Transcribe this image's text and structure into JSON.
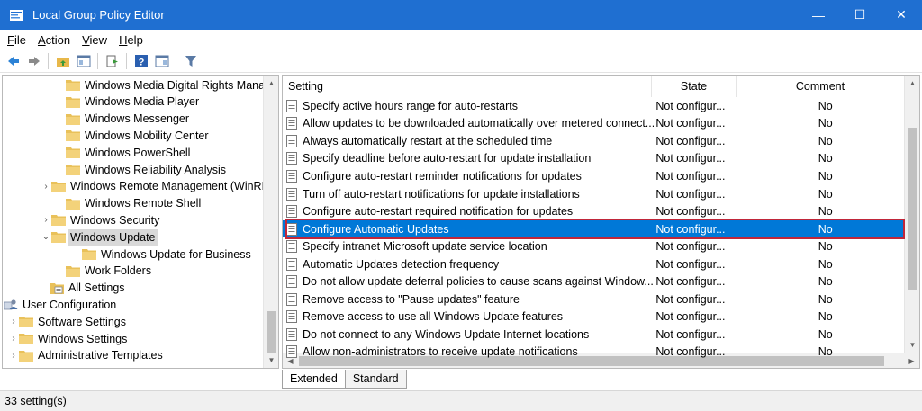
{
  "window": {
    "title": "Local Group Policy Editor",
    "accent_color": "#1f6fd1",
    "controls": {
      "minimize": "—",
      "maximize": "☐",
      "close": "✕"
    }
  },
  "menu": {
    "items": [
      {
        "label_u": "F",
        "label_rest": "ile"
      },
      {
        "label_u": "A",
        "label_rest": "ction"
      },
      {
        "label_u": "V",
        "label_rest": "iew"
      },
      {
        "label_u": "H",
        "label_rest": "elp"
      }
    ]
  },
  "toolbar": {
    "icons": [
      "back-arrow-icon",
      "forward-arrow-icon",
      "up-folder-icon",
      "show-hide-tree-icon",
      "export-list-icon",
      "help-icon",
      "show-hide-action-pane-icon",
      "filter-icon"
    ]
  },
  "tree": {
    "items": [
      {
        "label": "Windows Media Digital Rights Management",
        "expander": ""
      },
      {
        "label": "Windows Media Player",
        "expander": ""
      },
      {
        "label": "Windows Messenger",
        "expander": ""
      },
      {
        "label": "Windows Mobility Center",
        "expander": ""
      },
      {
        "label": "Windows PowerShell",
        "expander": ""
      },
      {
        "label": "Windows Reliability Analysis",
        "expander": ""
      },
      {
        "label": "Windows Remote Management (WinRM)",
        "expander": "›"
      },
      {
        "label": "Windows Remote Shell",
        "expander": ""
      },
      {
        "label": "Windows Security",
        "expander": "›"
      },
      {
        "label": "Windows Update",
        "expander": "⌄",
        "selected": true
      },
      {
        "label": "Windows Update for Business",
        "expander": ""
      },
      {
        "label": "Work Folders",
        "expander": ""
      },
      {
        "label": "All Settings",
        "expander": ""
      },
      {
        "label": "User Configuration",
        "expander": "⌄"
      },
      {
        "label": "Software Settings",
        "expander": "›"
      },
      {
        "label": "Windows Settings",
        "expander": "›"
      },
      {
        "label": "Administrative Templates",
        "expander": "›"
      }
    ]
  },
  "list": {
    "columns": {
      "setting": "Setting",
      "state": "State",
      "comment": "Comment"
    },
    "rows": [
      {
        "setting": "Specify active hours range for auto-restarts",
        "state": "Not configur...",
        "comment": "No"
      },
      {
        "setting": "Allow updates to be downloaded automatically over metered connect...",
        "state": "Not configur...",
        "comment": "No"
      },
      {
        "setting": "Always automatically restart at the scheduled time",
        "state": "Not configur...",
        "comment": "No"
      },
      {
        "setting": "Specify deadline before auto-restart for update installation",
        "state": "Not configur...",
        "comment": "No"
      },
      {
        "setting": "Configure auto-restart reminder notifications for updates",
        "state": "Not configur...",
        "comment": "No"
      },
      {
        "setting": "Turn off auto-restart notifications for update installations",
        "state": "Not configur...",
        "comment": "No"
      },
      {
        "setting": "Configure auto-restart required notification for updates",
        "state": "Not configur...",
        "comment": "No"
      },
      {
        "setting": "Configure Automatic Updates",
        "state": "Not configur...",
        "comment": "No",
        "selected": true
      },
      {
        "setting": "Specify intranet Microsoft update service location",
        "state": "Not configur...",
        "comment": "No"
      },
      {
        "setting": "Automatic Updates detection frequency",
        "state": "Not configur...",
        "comment": "No"
      },
      {
        "setting": "Do not allow update deferral policies to cause scans against Window...",
        "state": "Not configur...",
        "comment": "No"
      },
      {
        "setting": "Remove access to \"Pause updates\" feature",
        "state": "Not configur...",
        "comment": "No"
      },
      {
        "setting": "Remove access to use all Windows Update features",
        "state": "Not configur...",
        "comment": "No"
      },
      {
        "setting": "Do not connect to any Windows Update Internet locations",
        "state": "Not configur...",
        "comment": "No"
      },
      {
        "setting": "Allow non-administrators to receive update notifications",
        "state": "Not configur...",
        "comment": "No"
      }
    ],
    "selection_color": "#0078d7",
    "highlight_color": "#c0273a"
  },
  "tabs": [
    {
      "label": "Extended",
      "active": false
    },
    {
      "label": "Standard",
      "active": true
    }
  ],
  "status": {
    "text": "33 setting(s)"
  }
}
